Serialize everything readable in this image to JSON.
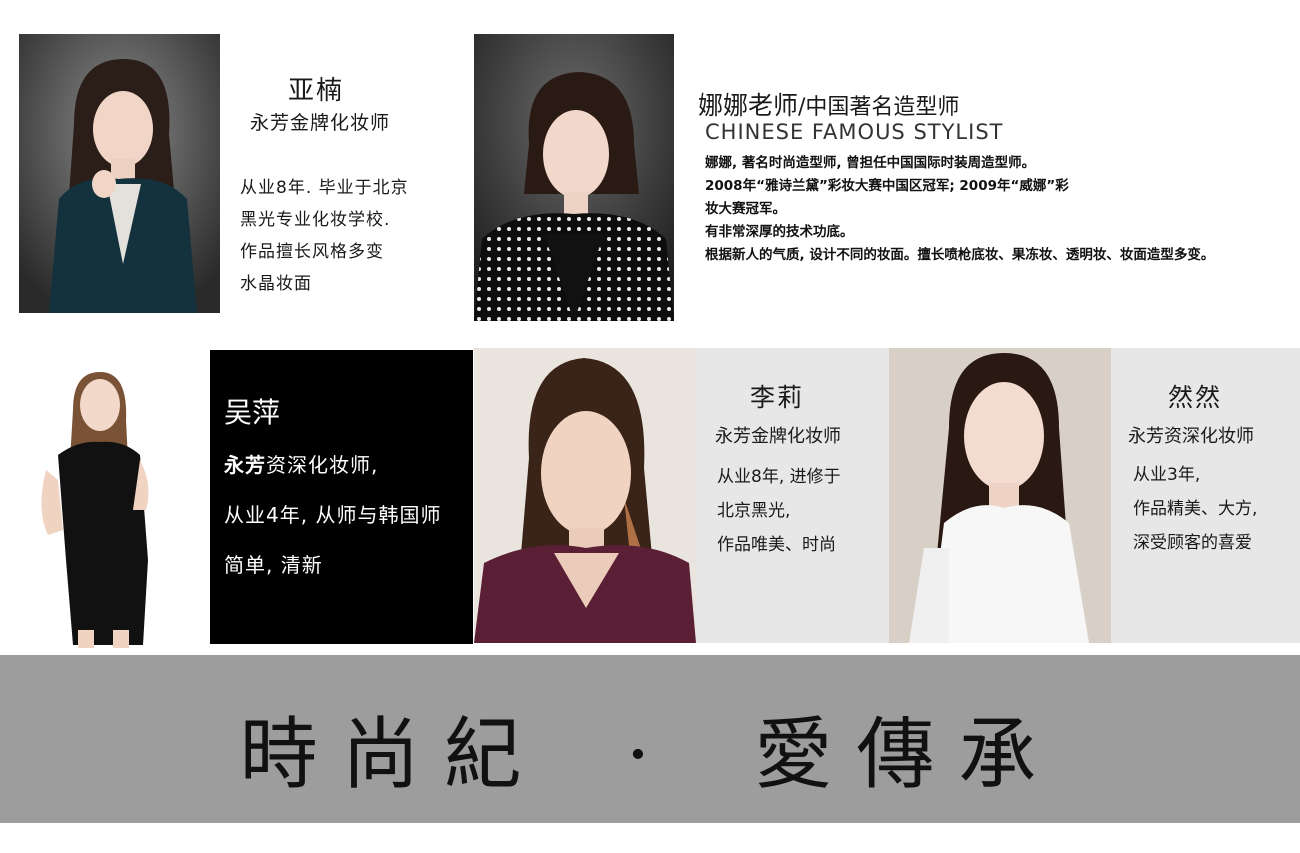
{
  "profiles": {
    "ya_nan": {
      "name": "亚楠",
      "title": "永芳金牌化妆师",
      "lines": [
        "从业8年. 毕业于北京",
        "黑光专业化妆学校.",
        "作品擅长风格多变",
        "水晶妆面"
      ]
    },
    "na_na": {
      "name": "娜娜老师",
      "name_suffix": "/中国著名造型师",
      "subtitle": "CHINESE FAMOUS STYLIST",
      "lines": [
        "娜娜, 著名时尚造型师, 曾担任中国国际时装周造型师。",
        "2008年“雅诗兰黛”彩妆大赛中国区冠军; 2009年“威娜”彩",
        "妆大赛冠军。",
        "有非常深厚的技术功底。",
        "根据新人的气质, 设计不同的妆面。擅长喷枪底妆、果冻妆、透明妆、妆面造型多变。"
      ]
    },
    "wu_ping": {
      "name": "吴萍",
      "title_bold": "永芳",
      "title_rest": "资深化妆师,",
      "lines": [
        "从业4年, 从师与韩国师",
        "简单, 清新"
      ]
    },
    "li_li": {
      "name": "李莉",
      "title": "永芳金牌化妆师",
      "lines": [
        "从业8年, 进修于",
        "北京黑光,",
        "作品唯美、时尚"
      ]
    },
    "ran_ran": {
      "name": "然然",
      "title": "永芳资深化妆师",
      "lines": [
        "从业3年,",
        "作品精美、大方,",
        "深受顾客的喜爱"
      ]
    }
  },
  "banner": {
    "left": "時尚紀",
    "dot": "·",
    "right": "愛傳承"
  },
  "colors": {
    "banner_bg": "#9d9d9d",
    "dark_panel": "#000000",
    "light_panel": "#e7e7e7"
  }
}
